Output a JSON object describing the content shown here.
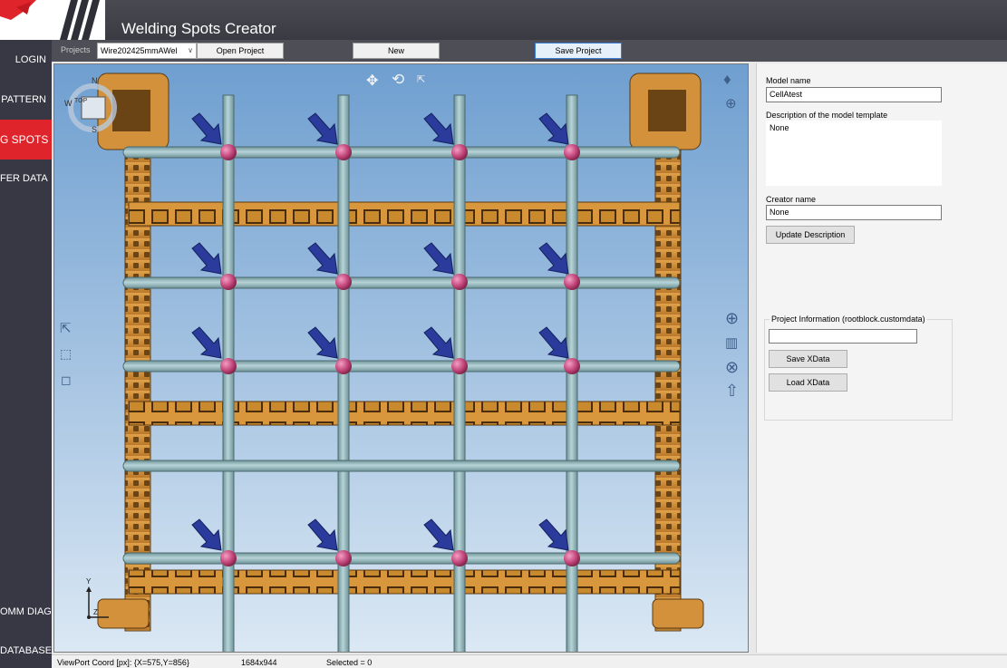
{
  "app": {
    "title": "Welding Spots Creator"
  },
  "sidebar": {
    "items": [
      {
        "label": "LOGIN"
      },
      {
        "label": "PATTERN"
      },
      {
        "label": "G SPOTS"
      },
      {
        "label": "FER DATA"
      },
      {
        "label": "OMM DIAG"
      },
      {
        "label": "DATABASE"
      }
    ],
    "active_index": 2
  },
  "toolbar": {
    "projects_label": "Projects",
    "project_value": "Wire202425mmAWel",
    "open_label": "Open Project",
    "new_label": "New",
    "save_label": "Save Project"
  },
  "viewport": {
    "viewcube": {
      "top": "TOP",
      "n": "N",
      "s": "S",
      "w": "W"
    },
    "axis": {
      "y": "Y",
      "z": "Z"
    }
  },
  "panel": {
    "model_name_label": "Model name",
    "model_name_value": "CellAtest",
    "description_label": "Description of the model template",
    "description_value": "None",
    "creator_label": "Creator name",
    "creator_value": "None",
    "update_label": "Update Description",
    "xdata_legend": "Project Information (rootblock.customdata)",
    "xdata_value": "",
    "save_xdata_label": "Save XData",
    "load_xdata_label": "Load XData"
  },
  "status": {
    "coords": "ViewPort Coord [px]: {X=575,Y=856}",
    "size": "1684x944",
    "selected": "Selected = 0"
  },
  "colors": {
    "accent": "#e0242b",
    "sidebar": "#383844",
    "frame": "#c98a2e",
    "rod": "#8fb3b8",
    "spot": "#c2457a",
    "arrow": "#2b3b9c"
  }
}
